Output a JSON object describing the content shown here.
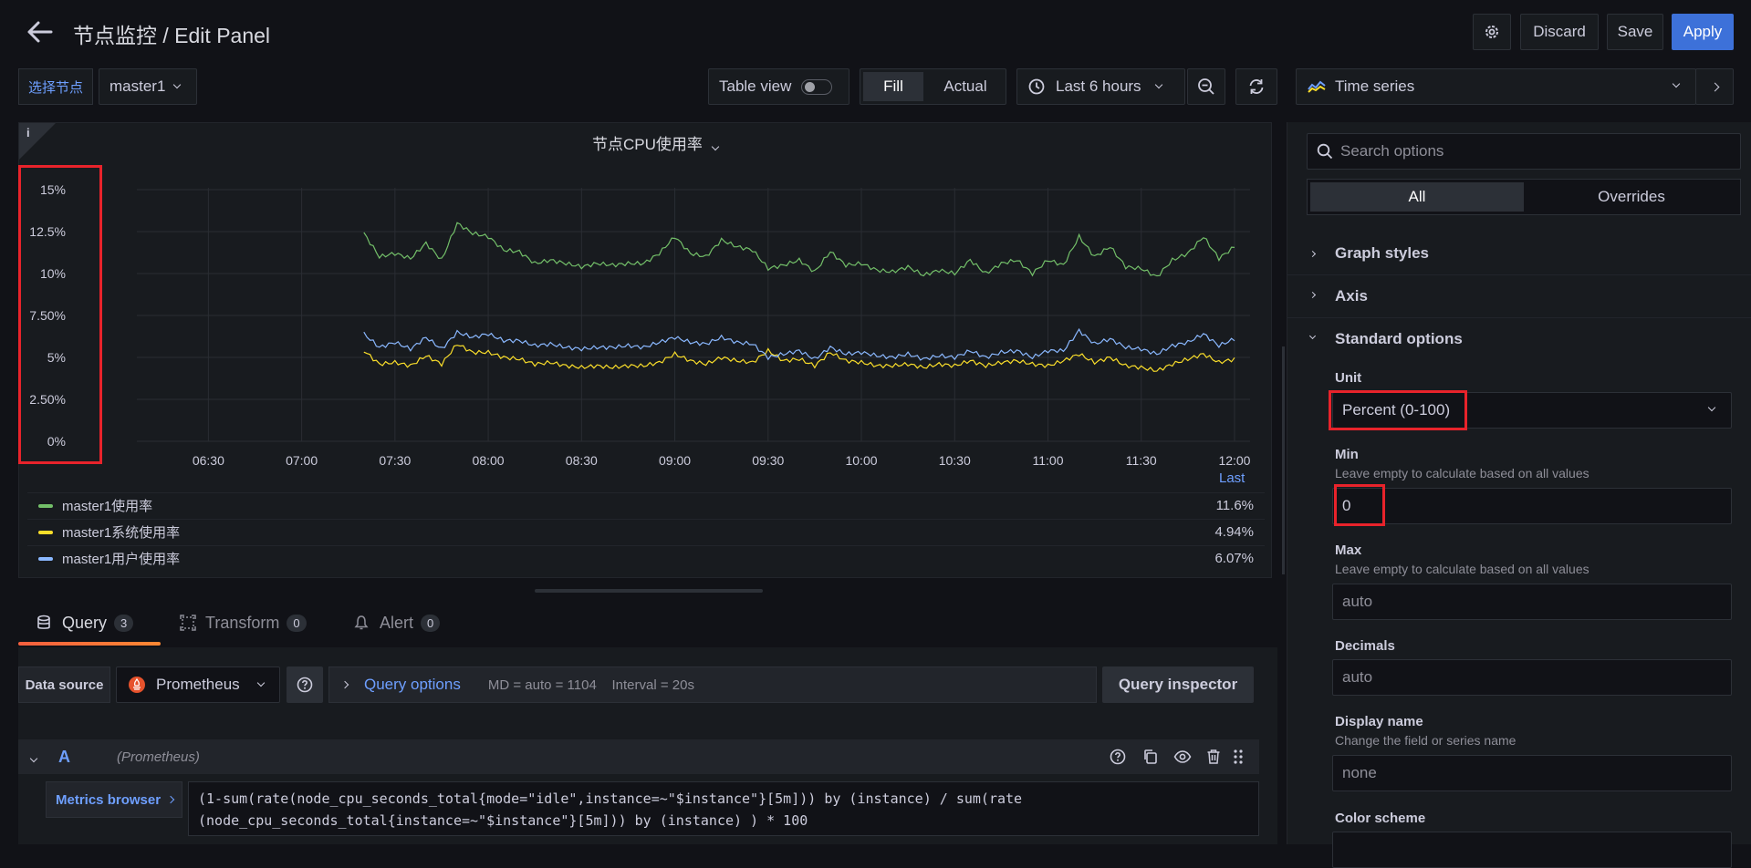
{
  "header": {
    "title": "节点监控 / Edit Panel",
    "discard_label": "Discard",
    "save_label": "Save",
    "apply_label": "Apply"
  },
  "toolbar": {
    "var_label": "选择节点",
    "var_value": "master1",
    "table_view_label": "Table view",
    "fill_label": "Fill",
    "actual_label": "Actual",
    "time_range": "Last 6 hours"
  },
  "panel": {
    "title": "节点CPU使用率",
    "info_icon": "i"
  },
  "chart_data": {
    "type": "line",
    "y_ticks": [
      "15%",
      "12.5%",
      "10%",
      "7.50%",
      "5%",
      "2.50%",
      "0%"
    ],
    "ylim": [
      0,
      15
    ],
    "x_ticks": [
      "06:30",
      "07:00",
      "07:30",
      "08:00",
      "08:30",
      "09:00",
      "09:30",
      "10:00",
      "10:30",
      "11:00",
      "11:30",
      "12:00"
    ],
    "legend_header": "Last",
    "series": [
      {
        "name": "master1使用率",
        "color": "#73bf69",
        "last": "11.6%",
        "x": [
          "07:20",
          "07:25",
          "07:30",
          "07:35",
          "07:40",
          "07:45",
          "07:50",
          "07:55",
          "08:00",
          "08:05",
          "08:10",
          "08:15",
          "08:20",
          "08:25",
          "08:30",
          "08:35",
          "08:40",
          "08:45",
          "08:50",
          "08:55",
          "09:00",
          "09:05",
          "09:10",
          "09:15",
          "09:20",
          "09:25",
          "09:30",
          "09:35",
          "09:40",
          "09:45",
          "09:50",
          "09:55",
          "10:00",
          "10:05",
          "10:10",
          "10:15",
          "10:20",
          "10:25",
          "10:30",
          "10:35",
          "10:40",
          "10:45",
          "10:50",
          "10:55",
          "11:00",
          "11:05",
          "11:10",
          "11:15",
          "11:20",
          "11:25",
          "11:30",
          "11:35",
          "11:40",
          "11:45",
          "11:50",
          "11:55",
          "12:00"
        ],
        "y": [
          12.4,
          11.0,
          11.2,
          10.9,
          11.8,
          10.8,
          13.0,
          12.4,
          12.2,
          11.4,
          11.3,
          10.6,
          10.8,
          10.6,
          10.4,
          10.6,
          10.5,
          10.6,
          10.6,
          11.2,
          12.2,
          11.2,
          11.0,
          12.0,
          11.6,
          11.4,
          10.3,
          10.5,
          10.8,
          10.1,
          11.3,
          10.5,
          10.6,
          10.2,
          10.1,
          10.4,
          9.9,
          10.2,
          10.0,
          10.8,
          10.0,
          10.6,
          10.8,
          10.0,
          10.8,
          10.5,
          12.2,
          11.0,
          11.6,
          10.4,
          10.3,
          9.8,
          10.8,
          11.2,
          12.2,
          10.9,
          11.6
        ]
      },
      {
        "name": "master1系统使用率",
        "color": "#fade2a",
        "last": "4.94%",
        "x": [
          "07:20",
          "07:25",
          "07:30",
          "07:35",
          "07:40",
          "07:45",
          "07:50",
          "07:55",
          "08:00",
          "08:05",
          "08:10",
          "08:15",
          "08:20",
          "08:25",
          "08:30",
          "08:35",
          "08:40",
          "08:45",
          "08:50",
          "08:55",
          "09:00",
          "09:05",
          "09:10",
          "09:15",
          "09:20",
          "09:25",
          "09:30",
          "09:35",
          "09:40",
          "09:45",
          "09:50",
          "09:55",
          "10:00",
          "10:05",
          "10:10",
          "10:15",
          "10:20",
          "10:25",
          "10:30",
          "10:35",
          "10:40",
          "10:45",
          "10:50",
          "10:55",
          "11:00",
          "11:05",
          "11:10",
          "11:15",
          "11:20",
          "11:25",
          "11:30",
          "11:35",
          "11:40",
          "11:45",
          "11:50",
          "11:55",
          "12:00"
        ],
        "y": [
          5.4,
          4.6,
          4.7,
          4.5,
          5.1,
          4.6,
          5.8,
          5.3,
          5.3,
          5.0,
          4.9,
          4.6,
          4.7,
          4.5,
          4.4,
          4.5,
          4.4,
          4.5,
          4.5,
          4.7,
          5.2,
          4.8,
          4.6,
          5.0,
          4.8,
          4.7,
          5.4,
          4.8,
          4.9,
          4.5,
          5.3,
          4.8,
          4.7,
          4.5,
          4.5,
          4.6,
          4.4,
          4.6,
          4.5,
          4.8,
          4.5,
          4.7,
          4.8,
          4.6,
          4.5,
          4.8,
          5.2,
          4.7,
          5.0,
          4.5,
          4.4,
          4.2,
          4.6,
          4.9,
          5.2,
          4.7,
          4.9
        ]
      },
      {
        "name": "master1用户使用率",
        "color": "#8ab8ff",
        "last": "6.07%",
        "x": [
          "07:20",
          "07:25",
          "07:30",
          "07:35",
          "07:40",
          "07:45",
          "07:50",
          "07:55",
          "08:00",
          "08:05",
          "08:10",
          "08:15",
          "08:20",
          "08:25",
          "08:30",
          "08:35",
          "08:40",
          "08:45",
          "08:50",
          "08:55",
          "09:00",
          "09:05",
          "09:10",
          "09:15",
          "09:20",
          "09:25",
          "09:30",
          "09:35",
          "09:40",
          "09:45",
          "09:50",
          "09:55",
          "10:00",
          "10:05",
          "10:10",
          "10:15",
          "10:20",
          "10:25",
          "10:30",
          "10:35",
          "10:40",
          "10:45",
          "10:50",
          "10:55",
          "11:00",
          "11:05",
          "11:10",
          "11:15",
          "11:20",
          "11:25",
          "11:30",
          "11:35",
          "11:40",
          "11:45",
          "11:50",
          "11:55",
          "12:00"
        ],
        "y": [
          6.4,
          5.6,
          5.9,
          5.5,
          6.2,
          5.5,
          6.5,
          6.2,
          6.4,
          6.0,
          6.0,
          5.7,
          5.8,
          5.6,
          5.5,
          5.6,
          5.6,
          5.7,
          5.6,
          5.9,
          6.2,
          5.9,
          5.8,
          6.2,
          5.9,
          5.8,
          5.0,
          5.2,
          5.4,
          4.9,
          5.6,
          5.2,
          5.3,
          5.1,
          5.0,
          5.2,
          4.9,
          5.1,
          5.0,
          5.4,
          5.0,
          5.3,
          5.4,
          5.0,
          5.4,
          5.4,
          6.6,
          5.8,
          6.1,
          5.6,
          5.5,
          5.2,
          5.7,
          5.9,
          6.4,
          5.7,
          6.1
        ]
      }
    ]
  },
  "query_tabs": [
    {
      "label": "Query",
      "count": "3"
    },
    {
      "label": "Transform",
      "count": "0"
    },
    {
      "label": "Alert",
      "count": "0"
    }
  ],
  "query": {
    "datasource_label": "Data source",
    "datasource_value": "Prometheus",
    "options_label": "Query options",
    "options_info": "MD = auto = 1104    Interval = 20s",
    "inspector_label": "Query inspector",
    "row_letter": "A",
    "row_source": "(Prometheus)",
    "metrics_browser_label": "Metrics browser",
    "expr_line1": "(1-sum(rate(node_cpu_seconds_total{mode=\"idle\",instance=~\"$instance\"}[5m])) by (instance) / sum(rate",
    "expr_line2": "(node_cpu_seconds_total{instance=~\"$instance\"}[5m])) by (instance) ) * 100"
  },
  "options_pane": {
    "viz_label": "Time series",
    "search_placeholder": "Search options",
    "tab_all": "All",
    "tab_overrides": "Overrides",
    "sections": {
      "graph_styles": "Graph styles",
      "axis": "Axis",
      "standard": "Standard options"
    },
    "unit_label": "Unit",
    "unit_value": "Percent (0-100)",
    "min_label": "Min",
    "min_desc": "Leave empty to calculate based on all values",
    "min_value": "0",
    "max_label": "Max",
    "max_desc": "Leave empty to calculate based on all values",
    "max_placeholder": "auto",
    "decimals_label": "Decimals",
    "decimals_placeholder": "auto",
    "display_name_label": "Display name",
    "display_name_desc": "Change the field or series name",
    "display_name_placeholder": "none",
    "color_scheme_label": "Color scheme"
  }
}
